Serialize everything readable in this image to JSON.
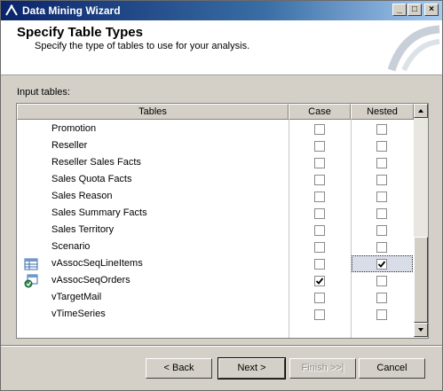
{
  "window": {
    "title": "Data Mining Wizard"
  },
  "header": {
    "title": "Specify Table Types",
    "subtitle": "Specify the type of tables to use for your analysis."
  },
  "input_label": "Input tables:",
  "grid": {
    "columns": [
      "Tables",
      "Case",
      "Nested"
    ],
    "rows": [
      {
        "name": "Promotion",
        "icon": "",
        "case": false,
        "nested": false
      },
      {
        "name": "Reseller",
        "icon": "",
        "case": false,
        "nested": false
      },
      {
        "name": "Reseller Sales Facts",
        "icon": "",
        "case": false,
        "nested": false
      },
      {
        "name": "Sales Quota Facts",
        "icon": "",
        "case": false,
        "nested": false
      },
      {
        "name": "Sales Reason",
        "icon": "",
        "case": false,
        "nested": false
      },
      {
        "name": "Sales Summary Facts",
        "icon": "",
        "case": false,
        "nested": false
      },
      {
        "name": "Sales Territory",
        "icon": "",
        "case": false,
        "nested": false
      },
      {
        "name": "Scenario",
        "icon": "",
        "case": false,
        "nested": false
      },
      {
        "name": "vAssocSeqLineItems",
        "icon": "nested-table-icon",
        "case": false,
        "nested": true
      },
      {
        "name": "vAssocSeqOrders",
        "icon": "case-table-icon",
        "case": true,
        "nested": false
      },
      {
        "name": "vTargetMail",
        "icon": "",
        "case": false,
        "nested": false
      },
      {
        "name": "vTimeSeries",
        "icon": "",
        "case": false,
        "nested": false
      }
    ]
  },
  "buttons": {
    "back": "< Back",
    "next": "Next >",
    "finish": "Finish >>|",
    "cancel": "Cancel"
  }
}
